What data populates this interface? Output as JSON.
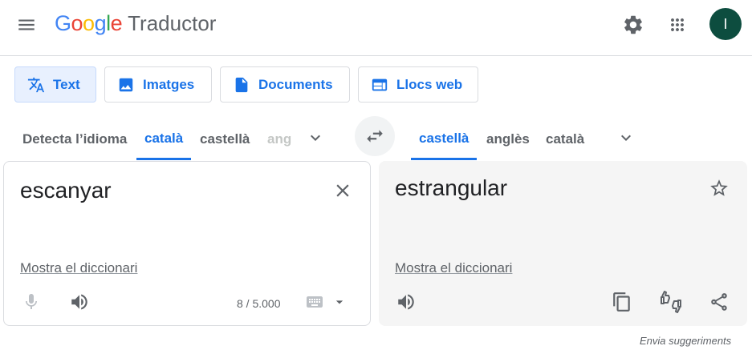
{
  "header": {
    "logo_letters": [
      "G",
      "o",
      "o",
      "g",
      "l",
      "e"
    ],
    "product": "Traductor",
    "avatar_initial": "I",
    "icons": [
      "menu-icon",
      "settings-icon",
      "apps-icon"
    ]
  },
  "modes": [
    {
      "label": "Text",
      "icon": "translate-icon",
      "active": true
    },
    {
      "label": "Imatges",
      "icon": "image-icon"
    },
    {
      "label": "Documents",
      "icon": "document-icon"
    },
    {
      "label": "Llocs web",
      "icon": "web-icon"
    }
  ],
  "source_langs": {
    "detect": "Detecta l’idioma",
    "items": [
      "català",
      "castellà",
      "ang"
    ],
    "selected": "català"
  },
  "target_langs": {
    "items": [
      "castellà",
      "anglès",
      "català"
    ],
    "selected": "castellà"
  },
  "source": {
    "text": "escanyar",
    "dictionary": "Mostra el diccionari",
    "counter": "8 / 5.000"
  },
  "target": {
    "text": "estrangular",
    "dictionary": "Mostra el diccionari"
  },
  "feedback": "Envia suggeriments",
  "colors": {
    "accent": "#1a73e8",
    "avatar": "#0d4d3f"
  }
}
